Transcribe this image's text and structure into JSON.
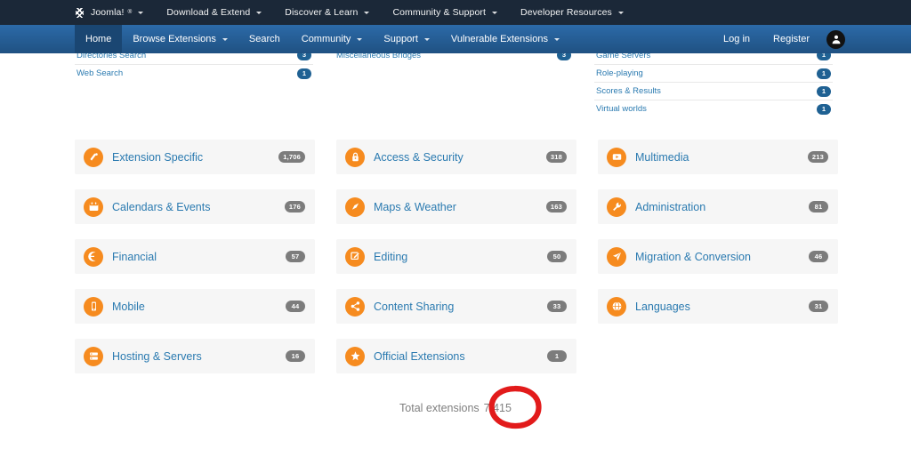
{
  "topbar": {
    "brand": {
      "label": "Joomla!",
      "sup": "®",
      "icon": "joomla-logo-icon"
    },
    "items": [
      {
        "label": "Download & Extend",
        "has_caret": true
      },
      {
        "label": "Discover & Learn",
        "has_caret": true
      },
      {
        "label": "Community & Support",
        "has_caret": true
      },
      {
        "label": "Developer Resources",
        "has_caret": true
      }
    ]
  },
  "navbar": {
    "items": [
      {
        "label": "Home",
        "has_caret": false,
        "active": true
      },
      {
        "label": "Browse Extensions",
        "has_caret": true,
        "active": false
      },
      {
        "label": "Search",
        "has_caret": false,
        "active": false
      },
      {
        "label": "Community",
        "has_caret": true,
        "active": false
      },
      {
        "label": "Support",
        "has_caret": true,
        "active": false
      },
      {
        "label": "Vulnerable Extensions",
        "has_caret": true,
        "active": false
      }
    ],
    "login_label": "Log in",
    "register_label": "Register",
    "avatar_icon": "user-avatar-icon"
  },
  "subcategories": {
    "columns": [
      {
        "rows": [
          {
            "label": "Directories Search",
            "count": "3",
            "clipped": true
          },
          {
            "label": "Web Search",
            "count": "1",
            "clipped": false
          }
        ]
      },
      {
        "rows": [
          {
            "label": "Miscellaneous Bridges",
            "count": "3",
            "clipped": true
          }
        ]
      },
      {
        "rows": [
          {
            "label": "Game Servers",
            "count": "1",
            "clipped": true
          },
          {
            "label": "Role-playing",
            "count": "1",
            "clipped": false
          },
          {
            "label": "Scores & Results",
            "count": "1",
            "clipped": false
          },
          {
            "label": "Virtual worlds",
            "count": "1",
            "clipped": false
          }
        ]
      }
    ]
  },
  "categories": {
    "columns": [
      [
        {
          "label": "Extension Specific",
          "count": "1,706",
          "icon": "extension-specific-icon"
        },
        {
          "label": "Calendars & Events",
          "count": "176",
          "icon": "calendar-icon"
        },
        {
          "label": "Financial",
          "count": "57",
          "icon": "financial-icon"
        },
        {
          "label": "Mobile",
          "count": "44",
          "icon": "mobile-icon"
        },
        {
          "label": "Hosting & Servers",
          "count": "16",
          "icon": "server-icon"
        }
      ],
      [
        {
          "label": "Access & Security",
          "count": "318",
          "icon": "lock-icon"
        },
        {
          "label": "Maps & Weather",
          "count": "163",
          "icon": "compass-icon"
        },
        {
          "label": "Editing",
          "count": "50",
          "icon": "pencil-edit-icon"
        },
        {
          "label": "Content Sharing",
          "count": "33",
          "icon": "share-icon"
        },
        {
          "label": "Official Extensions",
          "count": "1",
          "icon": "joomla-star-icon"
        }
      ],
      [
        {
          "label": "Multimedia",
          "count": "213",
          "icon": "play-media-icon"
        },
        {
          "label": "Administration",
          "count": "81",
          "icon": "wrench-icon"
        },
        {
          "label": "Migration & Conversion",
          "count": "46",
          "icon": "paper-plane-icon"
        },
        {
          "label": "Languages",
          "count": "31",
          "icon": "globe-icon"
        }
      ]
    ]
  },
  "footer": {
    "total_label": "Total extensions",
    "total_value": "7,415",
    "annotation": {
      "type": "hand-drawn-ellipse",
      "color": "#e21b1b",
      "targets": "total_value"
    }
  },
  "colors": {
    "topbar_bg": "#1b2838",
    "navbar_bg": "#2c6aa8",
    "navbar_active": "#1a4672",
    "link_blue": "#2a7ab0",
    "icon_orange": "#f68b1f",
    "card_bg": "#f6f6f6",
    "badge_gray": "#7c7c7c",
    "badge_blue": "#1f6193",
    "annotation_red": "#e21b1b",
    "muted_text": "#7f7f7f"
  }
}
